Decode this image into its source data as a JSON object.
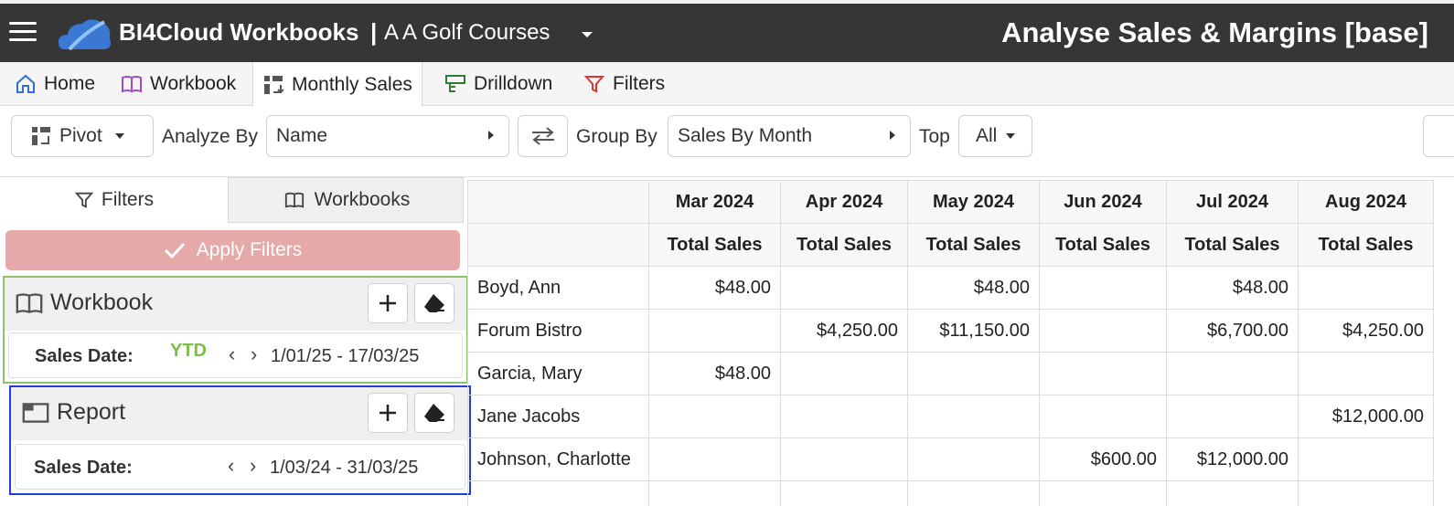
{
  "header": {
    "app_title": "BI4Cloud Workbooks",
    "separator": "|",
    "company": "A A Golf Courses",
    "page_title": "Analyse Sales & Margins [base]"
  },
  "tabs": [
    {
      "label": "Home",
      "icon": "home-icon"
    },
    {
      "label": "Workbook",
      "icon": "book-icon"
    },
    {
      "label": "Monthly Sales",
      "icon": "pivot-icon",
      "active": true
    },
    {
      "label": "Drilldown",
      "icon": "drilldown-icon"
    },
    {
      "label": "Filters",
      "icon": "filter-icon"
    }
  ],
  "toolbar": {
    "pivot_label": "Pivot",
    "analyze_by_label": "Analyze By",
    "analyze_by_value": "Name",
    "group_by_label": "Group By",
    "group_by_value": "Sales By Month",
    "top_label": "Top",
    "top_value": "All"
  },
  "sidepanel": {
    "tab_filters": "Filters",
    "tab_workbooks": "Workbooks",
    "apply_label": "Apply Filters",
    "workbook": {
      "title": "Workbook",
      "field_label": "Sales Date:",
      "badge": "YTD",
      "range": "1/01/25 - 17/03/25"
    },
    "report": {
      "title": "Report",
      "field_label": "Sales Date:",
      "range": "1/03/24 - 31/03/25"
    }
  },
  "colors": {
    "header_bg": "#363636",
    "apply_bg": "#e6a9a9",
    "workbook_border": "#8bc26a",
    "report_border": "#1f3fd8",
    "ytd": "#7bbf4a"
  },
  "grid": {
    "months": [
      "Mar 2024",
      "Apr 2024",
      "May 2024",
      "Jun 2024",
      "Jul 2024",
      "Aug 2024"
    ],
    "measure": "Total Sales",
    "rows": [
      {
        "name": "Boyd, Ann",
        "values": [
          "$48.00",
          "",
          "$48.00",
          "",
          "$48.00",
          ""
        ]
      },
      {
        "name": "Forum Bistro",
        "values": [
          "",
          "$4,250.00",
          "$11,150.00",
          "",
          "$6,700.00",
          "$4,250.00"
        ]
      },
      {
        "name": "Garcia, Mary",
        "values": [
          "$48.00",
          "",
          "",
          "",
          "",
          ""
        ]
      },
      {
        "name": "Jane Jacobs",
        "values": [
          "",
          "",
          "",
          "",
          "",
          "$12,000.00"
        ]
      },
      {
        "name": "Johnson, Charlotte",
        "values": [
          "",
          "",
          "",
          "$600.00",
          "$12,000.00",
          ""
        ]
      }
    ]
  }
}
